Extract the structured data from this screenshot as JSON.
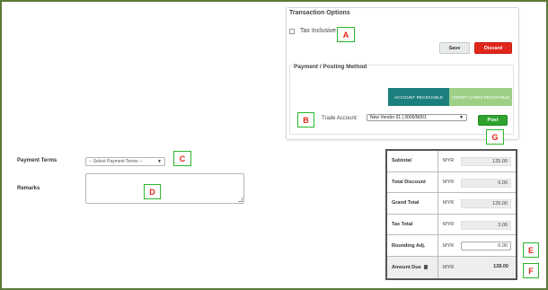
{
  "transaction_options": {
    "title": "Transaction Options",
    "tax_inclusive_label": "Tax Inclusive",
    "tax_inclusive_checked": false,
    "save_label": "Save",
    "discard_label": "Discard"
  },
  "posting": {
    "title": "Payment / Posting Method",
    "tab_account_receivable": "ACCOUNT RECEIVABLE",
    "tab_credit_cards": "CREDIT CARDS RECEIVABLE",
    "trade_account_label": "Trade Account:",
    "trade_account_value": "New Vendor 01 | 3000/N001",
    "post_label": "Post"
  },
  "form": {
    "payment_terms_label": "Payment Terms",
    "payment_terms_placeholder": "-- Select Payment Terms --",
    "remarks_label": "Remarks"
  },
  "totals": {
    "rows": [
      {
        "label": "Subtotal",
        "currency": "MYR",
        "value": "125.00"
      },
      {
        "label": "Total Discount",
        "currency": "MYR",
        "value": "0.00"
      },
      {
        "label": "Grand Total",
        "currency": "MYR",
        "value": "125.00"
      },
      {
        "label": "Tax Total",
        "currency": "MYR",
        "value": "3.00"
      },
      {
        "label": "Rounding Adj.",
        "currency": "MYR",
        "value": "0.00"
      },
      {
        "label": "Amount Due",
        "currency": "MYR",
        "value": "128.00"
      }
    ]
  },
  "callouts": {
    "a": "A",
    "b": "B",
    "c": "C",
    "d": "D",
    "e": "E",
    "f": "F",
    "g": "G"
  },
  "colors": {
    "frame": "#5a7a3a",
    "discard": "#e0261b",
    "post": "#2fa22f",
    "tab_active": "#1b7f7d",
    "tab_inactive": "#9dcf86",
    "callout_border": "#2db52d",
    "callout_text": "#e2231a"
  },
  "icons": {
    "trash": "trash-icon",
    "caret": "chevron-down-icon"
  }
}
